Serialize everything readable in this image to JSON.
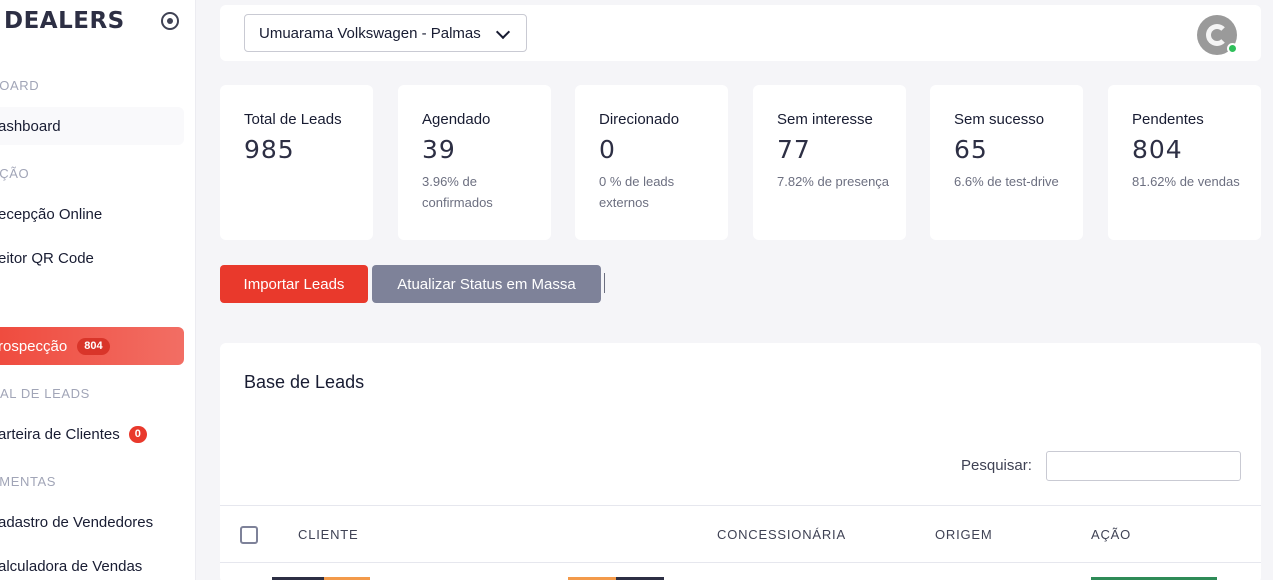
{
  "sidebar": {
    "brand": "DEALERS",
    "sections": [
      "BOARD",
      "PÇÃO",
      "RAL DE LEADS",
      "AMENTAS"
    ],
    "items": [
      {
        "label": "ashboard"
      },
      {
        "label": "ecepção Online"
      },
      {
        "label": "eitor QR Code"
      },
      {
        "label": "rospecção",
        "badge": "804"
      },
      {
        "label": "arteira de Clientes",
        "badge": "0"
      },
      {
        "label": "adastro de Vendedores"
      },
      {
        "label": "alculadora de Vendas"
      }
    ]
  },
  "header": {
    "dealer_select": "Umuarama Volkswagen - Palmas"
  },
  "stats": [
    {
      "title": "Total de Leads",
      "value": "985",
      "desc": ""
    },
    {
      "title": "Agendado",
      "value": "39",
      "desc": "3.96% de confirmados"
    },
    {
      "title": "Direcionado",
      "value": "0",
      "desc": "0 % de leads externos"
    },
    {
      "title": "Sem interesse",
      "value": "77",
      "desc": "7.82% de presença"
    },
    {
      "title": "Sem sucesso",
      "value": "65",
      "desc": "6.6% de test-drive"
    },
    {
      "title": "Pendentes",
      "value": "804",
      "desc": "81.62% de vendas"
    }
  ],
  "actions": {
    "import_label": "Importar Leads",
    "mass_update_label": "Atualizar Status em Massa"
  },
  "leads_table": {
    "title": "Base de Leads",
    "search_label": "Pesquisar:",
    "search_value": "",
    "columns": [
      "CLIENTE",
      "CONCESSIONÁRIA",
      "ORIGEM",
      "AÇÃO"
    ]
  },
  "colors": {
    "accent": "#e9392c",
    "secondary_button": "#7e8299",
    "online_status": "#2fbf5a"
  }
}
